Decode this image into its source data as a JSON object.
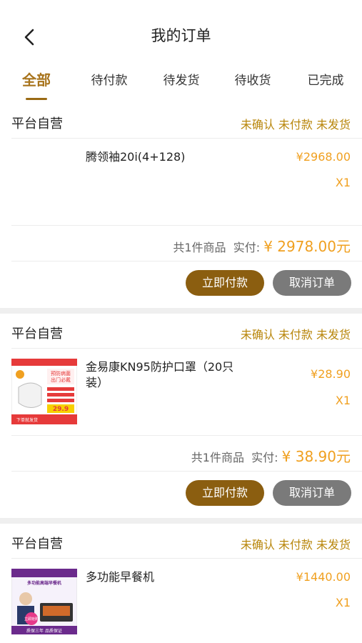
{
  "header": {
    "title": "我的订单"
  },
  "tabs": [
    "全部",
    "待付款",
    "待发货",
    "待收货",
    "已完成"
  ],
  "orders": [
    {
      "shop": "平台自营",
      "status": "未确认 未付款 未发货",
      "product": "腾领袖20i(4+128)",
      "price": "¥2968.00",
      "qty": "X1",
      "summary_count": "共1件商品",
      "summary_label": "实付:",
      "summary_amount": "¥ 2978.00元",
      "pay_label": "立即付款",
      "cancel_label": "取消订单"
    },
    {
      "shop": "平台自营",
      "status": "未确认 未付款 未发货",
      "product": "金易康KN95防护口罩（20只装）",
      "price": "¥28.90",
      "qty": "X1",
      "summary_count": "共1件商品",
      "summary_label": "实付:",
      "summary_amount": "¥ 38.90元",
      "pay_label": "立即付款",
      "cancel_label": "取消订单",
      "thumb_text": {
        "top": "预防病菌",
        "mid": "出门必戴",
        "price": "29.9",
        "bottom": "下单就发货"
      }
    },
    {
      "shop": "平台自营",
      "status": "未确认 未付款 未发货",
      "product": "多功能早餐机",
      "price": "¥1440.00",
      "qty": "X1",
      "thumb_text": {
        "top": "多功能高端早餐机",
        "badge": "立即抢购",
        "bottom": "质保三年 品质保证"
      }
    }
  ],
  "colors": {
    "accent": "#a8741c",
    "price": "#f0a020",
    "pay_button": "#8b5e10",
    "cancel_button": "#7a7a7a"
  }
}
